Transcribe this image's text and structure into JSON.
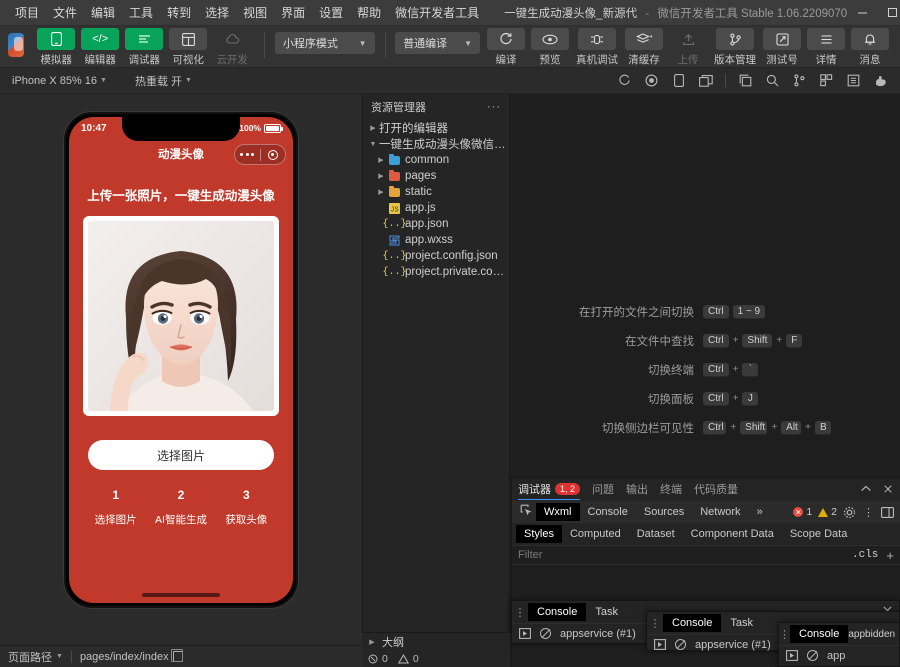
{
  "titlebar": {
    "menus": [
      "项目",
      "文件",
      "编辑",
      "工具",
      "转到",
      "选择",
      "视图",
      "界面",
      "设置",
      "帮助",
      "微信开发者工具"
    ],
    "project_name": "一键生成动漫头像_新源代",
    "separator": "-",
    "app_name": "微信开发者工具",
    "version": "Stable 1.06.2209070",
    "window_controls": {
      "minimize": "—",
      "maximize": "▢",
      "close": "✕"
    }
  },
  "toolbar": {
    "left_buttons": [
      {
        "label": "模拟器",
        "icon": "phone-icon",
        "state": "active"
      },
      {
        "label": "编辑器",
        "icon": "code-icon",
        "state": "active"
      },
      {
        "label": "调试器",
        "icon": "debug-icon",
        "state": "active"
      },
      {
        "label": "可视化",
        "icon": "layout-icon",
        "state": "normal"
      },
      {
        "label": "云开发",
        "icon": "cloud-icon",
        "state": "disabled"
      }
    ],
    "mode_select": "小程序模式",
    "compile_select": "普通编译",
    "action_buttons": [
      {
        "label": "编译",
        "icon": "refresh-icon"
      },
      {
        "label": "预览",
        "icon": "eye-icon"
      },
      {
        "label": "真机调试",
        "icon": "device-debug-icon"
      },
      {
        "label": "清缓存",
        "icon": "layers-icon"
      }
    ],
    "right_buttons": [
      {
        "label": "上传",
        "icon": "upload-icon",
        "state": "disabled"
      },
      {
        "label": "版本管理",
        "icon": "branch-icon",
        "state": "normal"
      },
      {
        "label": "测试号",
        "icon": "external-icon",
        "state": "normal"
      },
      {
        "label": "详情",
        "icon": "list-icon",
        "state": "normal"
      },
      {
        "label": "消息",
        "icon": "bell-icon",
        "state": "normal"
      }
    ]
  },
  "simbar": {
    "device": "iPhone X 85% 16",
    "hotreload": "热重载 开",
    "icons": [
      "rotate-icon",
      "record-icon",
      "device-icon",
      "window-icon"
    ]
  },
  "editor_tabbar": {
    "icons": [
      "copy-icon",
      "search-icon",
      "branch-icon",
      "extensions-icon",
      "snippet-icon",
      "hand-icon"
    ]
  },
  "simulator": {
    "status_time": "10:47",
    "battery_pct": "100%",
    "navbar_title": "动漫头像",
    "sub_heading": "上传一张照片，一键生成动漫头像",
    "pick_button": "选择图片",
    "steps": [
      {
        "num": "1",
        "label": "选择图片"
      },
      {
        "num": "2",
        "label": "AI智能生成"
      },
      {
        "num": "3",
        "label": "获取头像"
      }
    ],
    "theme_color": "#c0392b"
  },
  "explorer": {
    "title": "资源管理器",
    "more": "···",
    "open_editors": "打开的编辑器",
    "project_root": "一键生成动漫头像微信小程序",
    "files": [
      {
        "name": "common",
        "type": "folder",
        "color": "#3b9fd4"
      },
      {
        "name": "pages",
        "type": "folder",
        "color": "#e05a42"
      },
      {
        "name": "static",
        "type": "folder",
        "color": "#e2a33c"
      },
      {
        "name": "app.js",
        "type": "js",
        "color": "#e8c547"
      },
      {
        "name": "app.json",
        "type": "json",
        "color": "#e8c547"
      },
      {
        "name": "app.wxss",
        "type": "wxss",
        "color": "#4a90d9"
      },
      {
        "name": "project.config.json",
        "type": "json",
        "color": "#e8c547"
      },
      {
        "name": "project.private.config.js...",
        "type": "json",
        "color": "#e8c547"
      }
    ],
    "outline": "大纲",
    "problems": {
      "errors": "0",
      "warnings": "0"
    }
  },
  "shortcuts": [
    {
      "label": "在打开的文件之间切换",
      "keys": [
        "Ctrl",
        "1 ~ 9"
      ]
    },
    {
      "label": "在文件中查找",
      "keys": [
        "Ctrl",
        "+",
        "Shift",
        "+",
        "F"
      ]
    },
    {
      "label": "切换终端",
      "keys": [
        "Ctrl",
        "+",
        "`"
      ]
    },
    {
      "label": "切换面板",
      "keys": [
        "Ctrl",
        "+",
        "J"
      ]
    },
    {
      "label": "切换侧边栏可见性",
      "keys": [
        "Ctrl",
        "+",
        "Shift",
        "+",
        "Alt",
        "+",
        "B"
      ]
    }
  ],
  "debugger": {
    "tabs": [
      {
        "label": "调试器",
        "badge": "1, 2",
        "active": true
      },
      {
        "label": "问题",
        "active": false
      },
      {
        "label": "输出",
        "active": false
      },
      {
        "label": "终端",
        "active": false
      },
      {
        "label": "代码质量",
        "active": false
      }
    ],
    "collapse_icon": "chevron-up-icon",
    "close_icon": "close-icon",
    "subtabs": [
      {
        "label": "Wxml",
        "active": true
      },
      {
        "label": "Console",
        "active": false
      },
      {
        "label": "Sources",
        "active": false
      },
      {
        "label": "Network",
        "active": false
      },
      {
        "label": "»",
        "active": false
      }
    ],
    "error_count": "1",
    "warning_count": "2",
    "style_tabs": [
      {
        "label": "Styles",
        "active": true
      },
      {
        "label": "Computed",
        "active": false
      },
      {
        "label": "Dataset",
        "active": false
      },
      {
        "label": "Component Data",
        "active": false
      },
      {
        "label": "Scope Data",
        "active": false
      }
    ],
    "filter_placeholder": "Filter",
    "cls_label": ".cls",
    "plus_label": "+"
  },
  "consoles": [
    {
      "tabs": [
        "Console",
        "Task"
      ],
      "active": "Console",
      "target": "appservice (#1)",
      "has_close": true
    },
    {
      "tabs": [
        "Console",
        "Task"
      ],
      "active": "Console",
      "target": "appservice (#1)",
      "has_close": false
    },
    {
      "tabs": [
        "Console"
      ],
      "active": "Console",
      "target": "app",
      "label_extra": "appbidden",
      "has_close": false
    }
  ],
  "statusbar": {
    "page_path_label": "页面路径",
    "page_path_value": "pages/index/index",
    "copy_icon": "copy-icon",
    "right_icons": [
      "bug-icon",
      "eye-icon",
      "more-icon"
    ]
  }
}
